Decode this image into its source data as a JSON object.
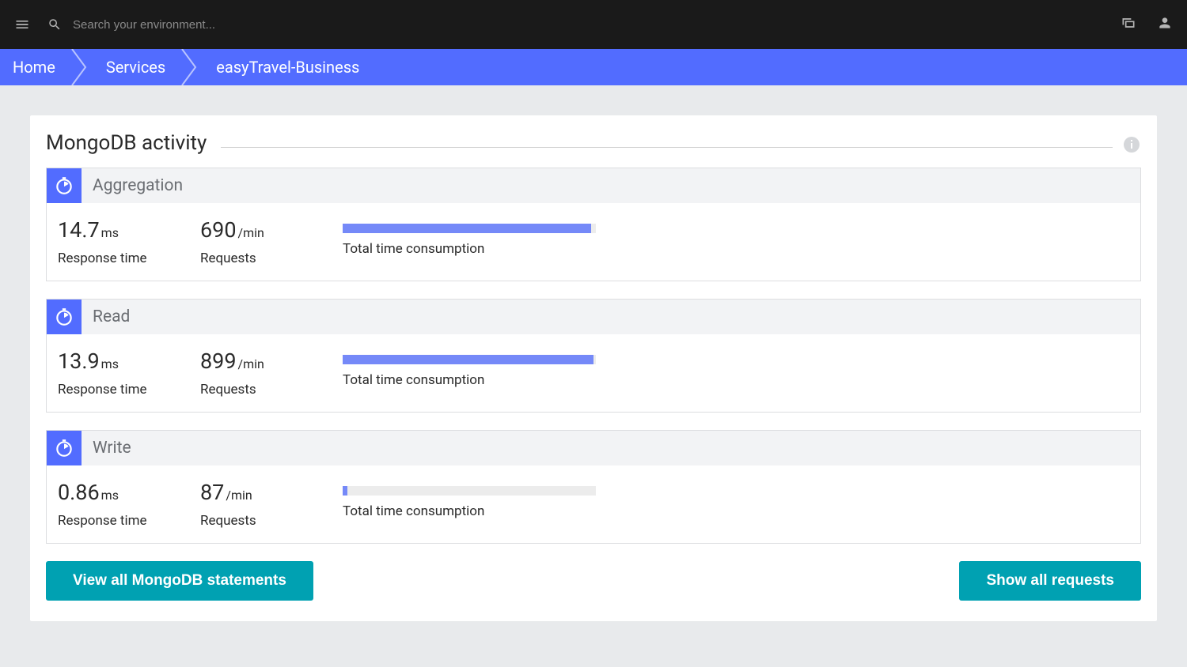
{
  "header": {
    "search_placeholder": "Search your environment..."
  },
  "breadcrumb": [
    "Home",
    "Services",
    "easyTravel-Business"
  ],
  "card": {
    "title": "MongoDB activity"
  },
  "labels": {
    "response_time": "Response time",
    "requests": "Requests",
    "total_time": "Total time consumption"
  },
  "activities": [
    {
      "name": "Aggregation",
      "response_value": "14.7",
      "response_unit": "ms",
      "requests_value": "690",
      "requests_unit": "/min",
      "bar_percent": 98
    },
    {
      "name": "Read",
      "response_value": "13.9",
      "response_unit": "ms",
      "requests_value": "899",
      "requests_unit": "/min",
      "bar_percent": 99
    },
    {
      "name": "Write",
      "response_value": "0.86",
      "response_unit": "ms",
      "requests_value": "87",
      "requests_unit": "/min",
      "bar_percent": 2
    }
  ],
  "buttons": {
    "view_statements": "View all MongoDB statements",
    "show_requests": "Show all requests"
  }
}
